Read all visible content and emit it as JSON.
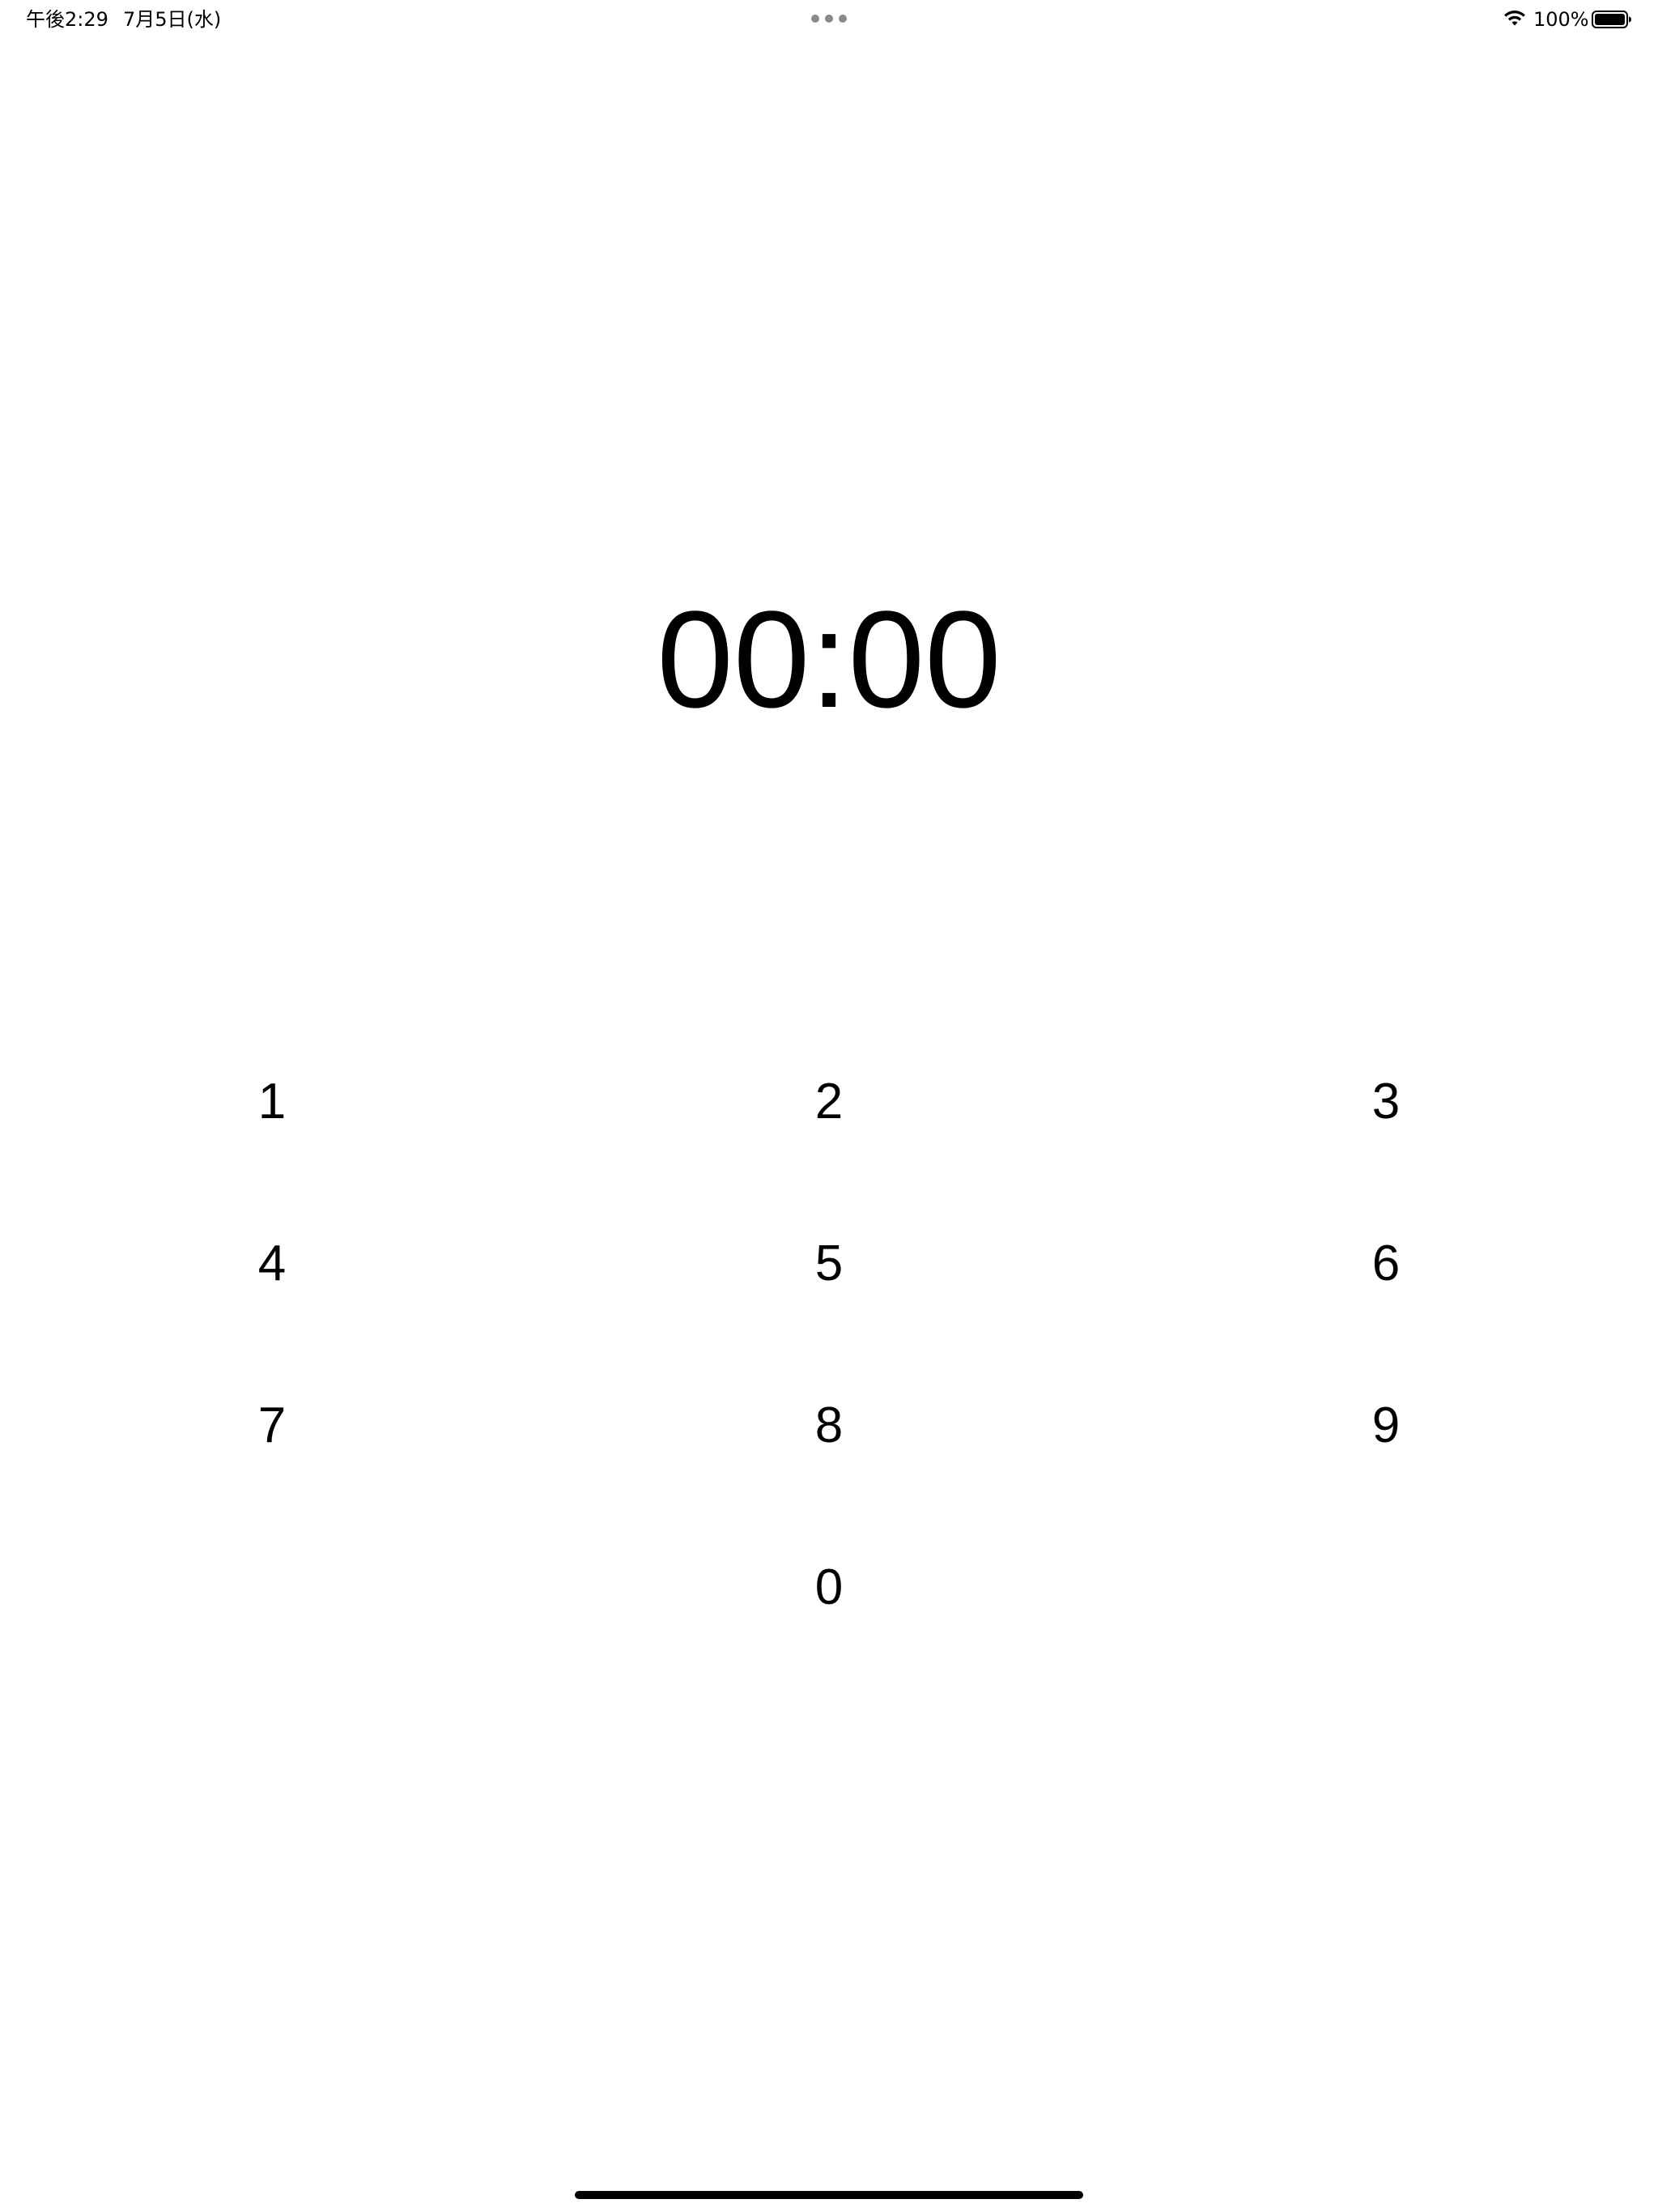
{
  "status_bar": {
    "time": "午後2:29",
    "date": "7月5日(水)",
    "battery_percent": "100%",
    "wifi_icon": "wifi-icon",
    "battery_icon": "battery-full-icon",
    "multitask_icon": "multitasking-dots-icon",
    "battery_level": 1.0
  },
  "timer": {
    "display": "00:00"
  },
  "keypad": {
    "keys": [
      "1",
      "2",
      "3",
      "4",
      "5",
      "6",
      "7",
      "8",
      "9",
      "0"
    ]
  },
  "colors": {
    "background": "#ffffff",
    "text": "#000000",
    "dots": "#8a8a8a"
  }
}
